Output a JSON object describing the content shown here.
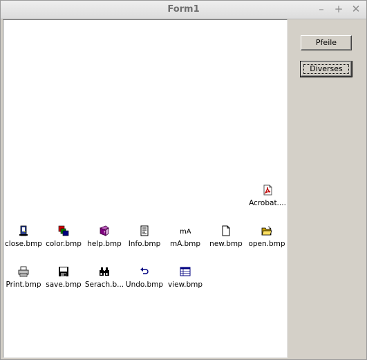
{
  "window": {
    "title": "Form1",
    "controls": {
      "minimize": "–",
      "maximize": "+",
      "close": "✕"
    }
  },
  "listview": {
    "items": [
      {
        "label": "Acrobat....",
        "icon": "acrobat-icon"
      },
      {
        "label": "close.bmp",
        "icon": "close-door-icon"
      },
      {
        "label": "color.bmp",
        "icon": "color-squares-icon"
      },
      {
        "label": "help.bmp",
        "icon": "help-book-icon"
      },
      {
        "label": "Info.bmp",
        "icon": "info-doc-icon"
      },
      {
        "label": "mA.bmp",
        "icon": "ma-text-icon"
      },
      {
        "label": "new.bmp",
        "icon": "new-file-icon"
      },
      {
        "label": "open.bmp",
        "icon": "open-folder-icon"
      },
      {
        "label": "Print.bmp",
        "icon": "printer-icon"
      },
      {
        "label": "save.bmp",
        "icon": "floppy-icon"
      },
      {
        "label": "Serach.b...",
        "icon": "binoculars-icon"
      },
      {
        "label": "Undo.bmp",
        "icon": "undo-arrow-icon"
      },
      {
        "label": "view.bmp",
        "icon": "view-list-icon"
      }
    ]
  },
  "buttons": {
    "pfeile": "Pfeile",
    "diverse": "Diverses"
  }
}
